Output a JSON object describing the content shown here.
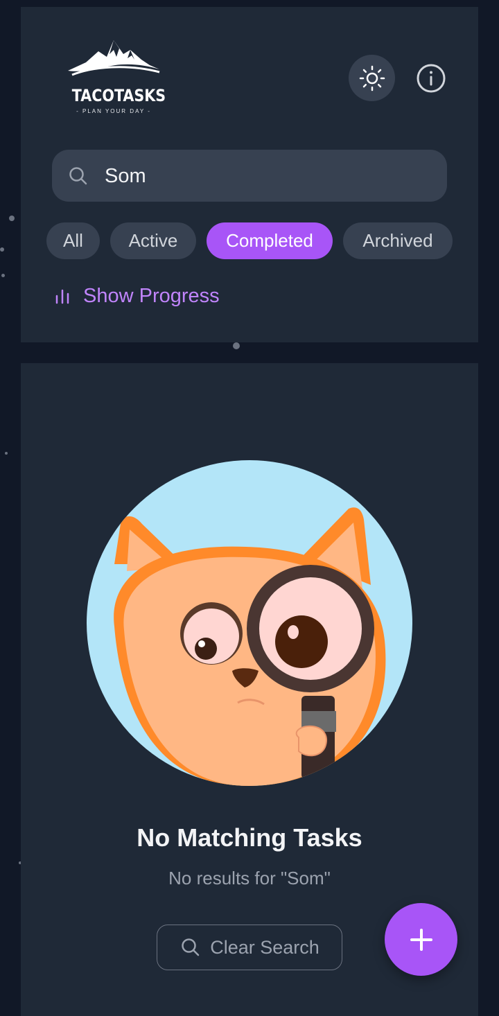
{
  "app": {
    "logo_title": "TACOTASKS",
    "logo_subtitle": "- PLAN YOUR DAY -"
  },
  "header": {
    "theme_toggle_icon": "sun-icon",
    "info_icon": "info-icon"
  },
  "search": {
    "value": "Som",
    "placeholder": "",
    "icon": "search-icon"
  },
  "filters": [
    {
      "label": "All",
      "selected": false
    },
    {
      "label": "Active",
      "selected": false
    },
    {
      "label": "Completed",
      "selected": true
    },
    {
      "label": "Archived",
      "selected": false
    }
  ],
  "progress_toggle": {
    "label": "Show Progress",
    "icon": "bar-chart-icon"
  },
  "empty_state": {
    "title": "No Matching Tasks",
    "subtitle": "No results for \"Som\"",
    "clear_button_label": "Clear Search",
    "illustration": "cat-with-magnifying-glass"
  },
  "fab": {
    "icon": "plus-icon"
  },
  "colors": {
    "background": "#111827",
    "card": "#1f2937",
    "chip": "#374151",
    "accent": "#a855f7",
    "accent_text": "#c084fc"
  }
}
